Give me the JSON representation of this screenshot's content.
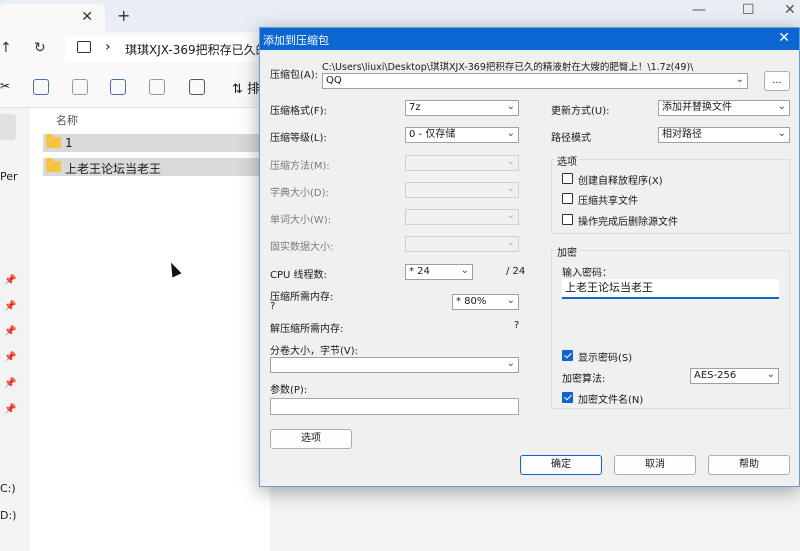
{
  "explorer": {
    "address_path": "琪琪XJX-369把积存已久的",
    "sort_label": "排",
    "column_name": "名称",
    "files": [
      {
        "name": "1"
      },
      {
        "name": "上老王论坛当老王"
      }
    ],
    "nav_text": "Per",
    "drives": [
      "C:)",
      "D:)"
    ]
  },
  "dialog": {
    "title": "添加到压缩包",
    "archive_label": "压缩包(A):",
    "archive_path": "C:\\Users\\liuxi\\Desktop\\琪琪XJX-369把积存已久的精液射在大嫂的肥臀上！\\1.7z(49)\\",
    "archive_name": "QQ",
    "browse_label": "...",
    "format_label": "压缩格式(F):",
    "format_value": "7z",
    "level_label": "压缩等级(L):",
    "level_value": "0 - 仅存储",
    "method_label": "压缩方法(M):",
    "dict_label": "字典大小(D):",
    "word_label": "单词大小(W):",
    "solid_label": "固实数据大小:",
    "threads_label": "CPU 线程数:",
    "threads_value": "* 24",
    "threads_total": "/ 24",
    "mem_comp_label": "压缩所需内存:",
    "mem_comp_value": "?",
    "mem_percent": "* 80%",
    "mem_decomp_label": "解压缩所需内存:",
    "mem_decomp_value": "?",
    "volume_label": "分卷大小，字节(V):",
    "params_label": "参数(P):",
    "options_button": "选项",
    "update_label": "更新方式(U):",
    "update_value": "添加并替换文件",
    "pathmode_label": "路径模式",
    "pathmode_value": "相对路径",
    "options_group": "选项",
    "opt_sfx": "创建自释放程序(X)",
    "opt_shared": "压缩共享文件",
    "opt_delete": "操作完成后删除源文件",
    "encrypt_group": "加密",
    "password_label": "输入密码：",
    "password_value": "上老王论坛当老王",
    "show_password": "显示密码(S)",
    "enc_method_label": "加密算法:",
    "enc_method_value": "AES-256",
    "encrypt_names": "加密文件名(N)",
    "ok": "确定",
    "cancel": "取消",
    "help": "帮助"
  }
}
